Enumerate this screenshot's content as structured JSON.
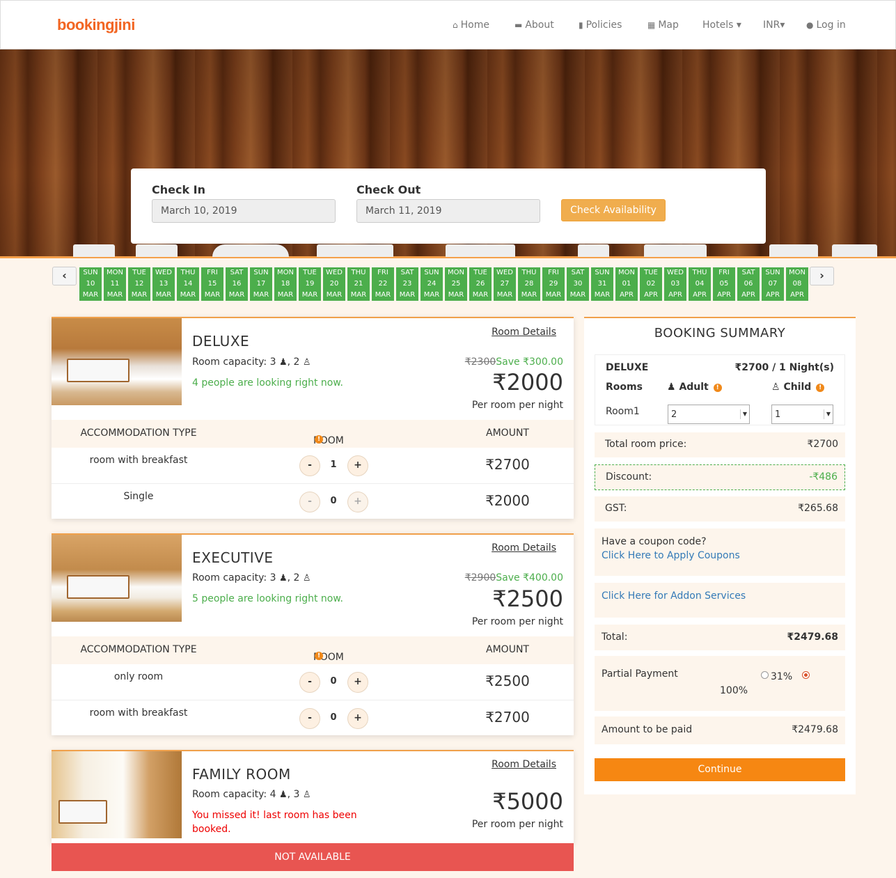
{
  "brand": {
    "logo_text": "bookingjini",
    "accent": "#f26522"
  },
  "nav": {
    "items": [
      {
        "label": "Home",
        "icon": "home-icon"
      },
      {
        "label": "About",
        "icon": "bed-icon"
      },
      {
        "label": "Policies",
        "icon": "file-icon"
      },
      {
        "label": "Map",
        "icon": "map-icon"
      },
      {
        "label": "Hotels ▾",
        "icon": ""
      },
      {
        "label": "INR▾",
        "icon": ""
      },
      {
        "label": "Log in",
        "icon": "user-icon"
      }
    ]
  },
  "search": {
    "checkin_label": "Check In",
    "checkin_value": "March 10, 2019",
    "checkout_label": "Check Out",
    "checkout_value": "March 11, 2019",
    "button_label": "Check Availability"
  },
  "date_strip": {
    "prev": "‹",
    "next": "›",
    "dates": [
      {
        "dow": "SUN",
        "day": "10",
        "mon": "MAR"
      },
      {
        "dow": "MON",
        "day": "11",
        "mon": "MAR"
      },
      {
        "dow": "TUE",
        "day": "12",
        "mon": "MAR"
      },
      {
        "dow": "WED",
        "day": "13",
        "mon": "MAR"
      },
      {
        "dow": "THU",
        "day": "14",
        "mon": "MAR"
      },
      {
        "dow": "FRI",
        "day": "15",
        "mon": "MAR"
      },
      {
        "dow": "SAT",
        "day": "16",
        "mon": "MAR"
      },
      {
        "dow": "SUN",
        "day": "17",
        "mon": "MAR"
      },
      {
        "dow": "MON",
        "day": "18",
        "mon": "MAR"
      },
      {
        "dow": "TUE",
        "day": "19",
        "mon": "MAR"
      },
      {
        "dow": "WED",
        "day": "20",
        "mon": "MAR"
      },
      {
        "dow": "THU",
        "day": "21",
        "mon": "MAR"
      },
      {
        "dow": "FRI",
        "day": "22",
        "mon": "MAR"
      },
      {
        "dow": "SAT",
        "day": "23",
        "mon": "MAR"
      },
      {
        "dow": "SUN",
        "day": "24",
        "mon": "MAR"
      },
      {
        "dow": "MON",
        "day": "25",
        "mon": "MAR"
      },
      {
        "dow": "TUE",
        "day": "26",
        "mon": "MAR"
      },
      {
        "dow": "WED",
        "day": "27",
        "mon": "MAR"
      },
      {
        "dow": "THU",
        "day": "28",
        "mon": "MAR"
      },
      {
        "dow": "FRI",
        "day": "29",
        "mon": "MAR"
      },
      {
        "dow": "SAT",
        "day": "30",
        "mon": "MAR"
      },
      {
        "dow": "SUN",
        "day": "31",
        "mon": "MAR"
      },
      {
        "dow": "MON",
        "day": "01",
        "mon": "APR"
      },
      {
        "dow": "TUE",
        "day": "02",
        "mon": "APR"
      },
      {
        "dow": "WED",
        "day": "03",
        "mon": "APR"
      },
      {
        "dow": "THU",
        "day": "04",
        "mon": "APR"
      },
      {
        "dow": "FRI",
        "day": "05",
        "mon": "APR"
      },
      {
        "dow": "SAT",
        "day": "06",
        "mon": "APR"
      },
      {
        "dow": "SUN",
        "day": "07",
        "mon": "APR"
      },
      {
        "dow": "MON",
        "day": "08",
        "mon": "APR"
      }
    ]
  },
  "rooms": [
    {
      "name": "DELUXE",
      "details_link": "Room Details",
      "capacity_label": "Room capacity: 3",
      "child_count": "2",
      "looking": "4 people are looking right now.",
      "old_price": "₹2300",
      "save": "Save ₹300.00",
      "price": "₹2000",
      "per_night": "Per room per night",
      "table_headers": {
        "type": "ACCOMMODATION TYPE",
        "room": "ROOM",
        "amount": "AMOUNT"
      },
      "rows": [
        {
          "type": "room with breakfast",
          "qty": "1",
          "amount": "₹2700"
        },
        {
          "type": "Single",
          "qty": "0",
          "amount": "₹2000"
        }
      ]
    },
    {
      "name": "EXECUTIVE",
      "details_link": "Room Details",
      "capacity_label": "Room capacity: 3",
      "child_count": "2",
      "looking": "5 people are looking right now.",
      "old_price": "₹2900",
      "save": "Save ₹400.00",
      "price": "₹2500",
      "per_night": "Per room per night",
      "table_headers": {
        "type": "ACCOMMODATION TYPE",
        "room": "ROOM",
        "amount": "AMOUNT"
      },
      "rows": [
        {
          "type": "only room",
          "qty": "0",
          "amount": "₹2500"
        },
        {
          "type": "room with breakfast",
          "qty": "0",
          "amount": "₹2700"
        }
      ]
    },
    {
      "name": "FAMILY ROOM",
      "details_link": "Room Details",
      "capacity_label": "Room capacity: 4",
      "child_count": "3",
      "missed": "You missed it! last room has been booked.",
      "price": "₹5000",
      "per_night": "Per room per night",
      "unavailable": "NOT AVAILABLE"
    }
  ],
  "qty_minus": "-",
  "qty_plus": "+",
  "summary": {
    "title": "BOOKING SUMMARY",
    "room_name": "DELUXE",
    "room_rate": "₹2700 / 1 Night(s)",
    "rooms_label": "Rooms",
    "adult_label": "Adult",
    "child_label": "Child",
    "room_row_label": "Room1",
    "adult_value": "2",
    "child_value": "1",
    "total_room_price_label": "Total room price:",
    "total_room_price": "₹2700",
    "discount_label": "Discount:",
    "discount": "-₹486",
    "gst_label": "GST:",
    "gst": "₹265.68",
    "coupon_question": "Have a coupon code?",
    "coupon_link": "Click Here to Apply Coupons",
    "addon_link": "Click Here for Addon Services",
    "total_label": "Total:",
    "total": "₹2479.68",
    "partial_label": "Partial Payment",
    "partial_option_1": "31%",
    "partial_option_2": "100%",
    "amount_paid_label": "Amount to be paid",
    "amount_paid": "₹2479.68",
    "continue_label": "Continue"
  }
}
